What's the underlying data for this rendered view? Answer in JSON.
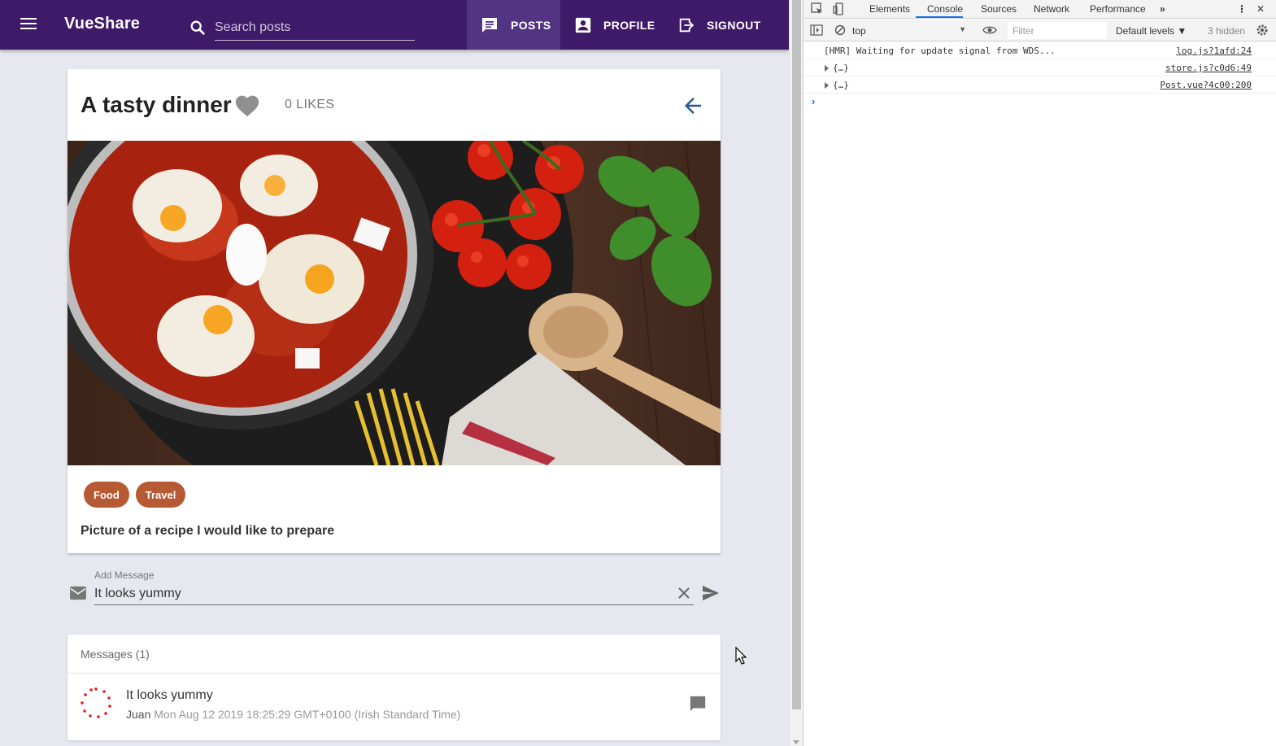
{
  "toolbar": {
    "title": "VueShare",
    "search_placeholder": "Search posts",
    "nav": {
      "posts": "POSTS",
      "profile": "PROFILE",
      "signout": "SIGNOUT"
    },
    "color": "#3f1a68",
    "active_color": "#533483"
  },
  "post": {
    "title": "A tasty dinner",
    "likes": "0 LIKES",
    "tags": [
      "Food",
      "Travel"
    ],
    "description": "Picture of a recipe I would like to prepare"
  },
  "message_input": {
    "label": "Add Message",
    "value": "It looks yummy"
  },
  "messages": {
    "header": "Messages (1)",
    "items": [
      {
        "text": "It looks yummy",
        "author": "Juan",
        "date": "Mon Aug 12 2019 18:25:29 GMT+0100 (Irish Standard Time)"
      }
    ]
  },
  "devtools": {
    "tabs": [
      "Elements",
      "Console",
      "Sources",
      "Network",
      "Performance"
    ],
    "active_tab": "Console",
    "context": "top",
    "filter_placeholder": "Filter",
    "levels": "Default levels ▼",
    "hidden": "3 hidden",
    "logs": [
      {
        "message": "[HMR] Waiting for update signal from WDS...",
        "source": "log.js?1afd:24"
      },
      {
        "message": "{…}",
        "source": "store.js?c0d6:49"
      },
      {
        "message": "{…}",
        "source": "Post.vue?4c00:200"
      }
    ],
    "prompt": "›"
  },
  "icons": {
    "menu": "menu-icon",
    "search": "search-icon",
    "heart": "heart-icon",
    "back": "arrow-left-icon",
    "mail": "mail-icon",
    "clear": "close-icon",
    "send": "send-icon",
    "comment": "comment-icon"
  }
}
